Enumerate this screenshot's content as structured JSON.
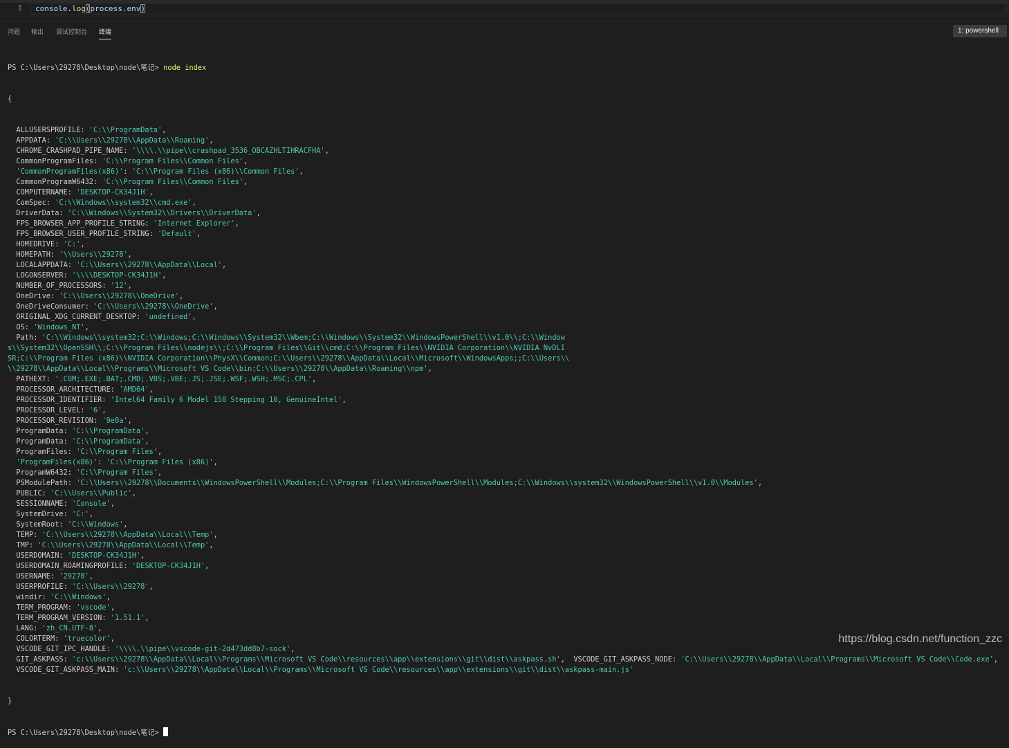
{
  "editor": {
    "line_number": "1",
    "code_object": "console",
    "code_dot": ".",
    "code_fn": "log",
    "code_open": "(",
    "code_arg": "process",
    "code_dot2": ".",
    "code_prop": "env",
    "code_close": ")"
  },
  "panel": {
    "tabs": [
      "问题",
      "输出",
      "调试控制台",
      "终端"
    ],
    "active_tab": "终端",
    "terminal_select": "1: powershell"
  },
  "terminal": {
    "prompt": "PS C:\\Users\\29278\\Desktop\\node\\笔记> ",
    "command": "node index",
    "open_brace": "{",
    "close_brace": "}",
    "entries": [
      {
        "key": "  ALLUSERSPROFILE: ",
        "val": "'C:\\\\ProgramData'",
        "end": ","
      },
      {
        "key": "  APPDATA: ",
        "val": "'C:\\\\Users\\\\29278\\\\AppData\\\\Roaming'",
        "end": ","
      },
      {
        "key": "  CHROME_CRASHPAD_PIPE_NAME: ",
        "val": "'\\\\\\\\.\\\\pipe\\\\crashpad_3536_OBCAZHLTIHRACFHA'",
        "end": ","
      },
      {
        "key": "  CommonProgramFiles: ",
        "val": "'C:\\\\Program Files\\\\Common Files'",
        "end": ","
      },
      {
        "key": "  ",
        "val": "'CommonProgramFiles(x86)'",
        "mid": ": ",
        "val2": "'C:\\\\Program Files (x86)\\\\Common Files'",
        "end": ","
      },
      {
        "key": "  CommonProgramW6432: ",
        "val": "'C:\\\\Program Files\\\\Common Files'",
        "end": ","
      },
      {
        "key": "  COMPUTERNAME: ",
        "val": "'DESKTOP-CK34J1H'",
        "end": ","
      },
      {
        "key": "  ComSpec: ",
        "val": "'C:\\\\Windows\\\\system32\\\\cmd.exe'",
        "end": ","
      },
      {
        "key": "  DriverData: ",
        "val": "'C:\\\\Windows\\\\System32\\\\Drivers\\\\DriverData'",
        "end": ","
      },
      {
        "key": "  FPS_BROWSER_APP_PROFILE_STRING: ",
        "val": "'Internet Explorer'",
        "end": ","
      },
      {
        "key": "  FPS_BROWSER_USER_PROFILE_STRING: ",
        "val": "'Default'",
        "end": ","
      },
      {
        "key": "  HOMEDRIVE: ",
        "val": "'C:'",
        "end": ","
      },
      {
        "key": "  HOMEPATH: ",
        "val": "'\\\\Users\\\\29278'",
        "end": ","
      },
      {
        "key": "  LOCALAPPDATA: ",
        "val": "'C:\\\\Users\\\\29278\\\\AppData\\\\Local'",
        "end": ","
      },
      {
        "key": "  LOGONSERVER: ",
        "val": "'\\\\\\\\DESKTOP-CK34J1H'",
        "end": ","
      },
      {
        "key": "  NUMBER_OF_PROCESSORS: ",
        "val": "'12'",
        "end": ","
      },
      {
        "key": "  OneDrive: ",
        "val": "'C:\\\\Users\\\\29278\\\\OneDrive'",
        "end": ","
      },
      {
        "key": "  OneDriveConsumer: ",
        "val": "'C:\\\\Users\\\\29278\\\\OneDrive'",
        "end": ","
      },
      {
        "key": "  ORIGINAL_XDG_CURRENT_DESKTOP: ",
        "val": "'undefined'",
        "end": ","
      },
      {
        "key": "  OS: ",
        "val": "'Windows_NT'",
        "end": ","
      },
      {
        "key": "  Path: ",
        "val": "'C:\\\\Windows\\\\system32;C:\\\\Windows;C:\\\\Windows\\\\System32\\\\Wbem;C:\\\\Windows\\\\System32\\\\WindowsPowerShell\\\\v1.0\\\\;C:\\\\Window",
        "end": ""
      },
      {
        "key": "",
        "val": "s\\\\System32\\\\OpenSSH\\\\;C:\\\\Program Files\\\\nodejs\\\\;C:\\\\Program Files\\\\Git\\\\cmd;C:\\\\Program Files\\\\NVIDIA Corporation\\\\NVIDIA NvDLI",
        "end": ""
      },
      {
        "key": "",
        "val": "SR;C:\\\\Program Files (x86)\\\\NVIDIA Corporation\\\\PhysX\\\\Common;C:\\\\Users\\\\29278\\\\AppData\\\\Local\\\\Microsoft\\\\WindowsApps;;C:\\\\Users\\\\",
        "end": ""
      },
      {
        "key": "",
        "val": "\\\\29278\\\\AppData\\\\Local\\\\Programs\\\\Microsoft VS Code\\\\bin;C:\\\\Users\\\\29278\\\\AppData\\\\Roaming\\\\npm'",
        "end": ","
      },
      {
        "key": "  PATHEXT: ",
        "val": "'.COM;.EXE;.BAT;.CMD;.VBS;.VBE;.JS;.JSE;.WSF;.WSH;.MSC;.CPL'",
        "end": ","
      },
      {
        "key": "  PROCESSOR_ARCHITECTURE: ",
        "val": "'AMD64'",
        "end": ","
      },
      {
        "key": "  PROCESSOR_IDENTIFIER: ",
        "val": "'Intel64 Family 6 Model 158 Stepping 10, GenuineIntel'",
        "end": ","
      },
      {
        "key": "  PROCESSOR_LEVEL: ",
        "val": "'6'",
        "end": ","
      },
      {
        "key": "  PROCESSOR_REVISION: ",
        "val": "'9e0a'",
        "end": ","
      },
      {
        "key": "  ProgramData: ",
        "val": "'C:\\\\ProgramData'",
        "end": ","
      },
      {
        "key": "  ProgramData: ",
        "val": "'C:\\\\ProgramData'",
        "end": ","
      },
      {
        "key": "  ProgramFiles: ",
        "val": "'C:\\\\Program Files'",
        "end": ","
      },
      {
        "key": "  ",
        "val": "'ProgramFiles(x86)'",
        "mid": ": ",
        "val2": "'C:\\\\Program Files (x86)'",
        "end": ","
      },
      {
        "key": "  ProgramW6432: ",
        "val": "'C:\\\\Program Files'",
        "end": ","
      },
      {
        "key": "  PSModulePath: ",
        "val": "'C:\\\\Users\\\\29278\\\\Documents\\\\WindowsPowerShell\\\\Modules;C:\\\\Program Files\\\\WindowsPowerShell\\\\Modules;C:\\\\Windows\\\\system32\\\\WindowsPowerShell\\\\v1.0\\\\Modules'",
        "end": ","
      },
      {
        "key": "  PUBLIC: ",
        "val": "'C:\\\\Users\\\\Public'",
        "end": ","
      },
      {
        "key": "  SESSIONNAME: ",
        "val": "'Console'",
        "end": ","
      },
      {
        "key": "  SystemDrive: ",
        "val": "'C:'",
        "end": ","
      },
      {
        "key": "  SystemRoot: ",
        "val": "'C:\\\\Windows'",
        "end": ","
      },
      {
        "key": "  TEMP: ",
        "val": "'C:\\\\Users\\\\29278\\\\AppData\\\\Local\\\\Temp'",
        "end": ","
      },
      {
        "key": "  TMP: ",
        "val": "'C:\\\\Users\\\\29278\\\\AppData\\\\Local\\\\Temp'",
        "end": ","
      },
      {
        "key": "  USERDOMAIN: ",
        "val": "'DESKTOP-CK34J1H'",
        "end": ","
      },
      {
        "key": "  USERDOMAIN_ROAMINGPROFILE: ",
        "val": "'DESKTOP-CK34J1H'",
        "end": ","
      },
      {
        "key": "  USERNAME: ",
        "val": "'29278'",
        "end": ","
      },
      {
        "key": "  USERPROFILE: ",
        "val": "'C:\\\\Users\\\\29278'",
        "end": ","
      },
      {
        "key": "  windir: ",
        "val": "'C:\\\\Windows'",
        "end": ","
      },
      {
        "key": "  TERM_PROGRAM: ",
        "val": "'vscode'",
        "end": ","
      },
      {
        "key": "  TERM_PROGRAM_VERSION: ",
        "val": "'1.51.1'",
        "end": ","
      },
      {
        "key": "  LANG: ",
        "val": "'zh_CN.UTF-8'",
        "end": ","
      },
      {
        "key": "  COLORTERM: ",
        "val": "'truecolor'",
        "end": ","
      },
      {
        "key": "  VSCODE_GIT_IPC_HANDLE: ",
        "val": "'\\\\\\\\.\\\\pipe\\\\vscode-git-2d473dd8b7-sock'",
        "end": ","
      },
      {
        "key": "  GIT_ASKPASS: ",
        "val": "'c:\\\\Users\\\\29278\\\\AppData\\\\Local\\\\Programs\\\\Microsoft VS Code\\\\resources\\\\app\\\\extensions\\\\git\\\\dist\\\\askpass.sh'",
        "mid": ",  VSCODE_GIT_ASKPASS_NODE: ",
        "val2": "'C:\\\\Users\\\\29278\\\\AppData\\\\Local\\\\Programs\\\\Microsoft VS Code\\\\Code.exe'",
        "end": ","
      },
      {
        "key": "  VSCODE_GIT_ASKPASS_MAIN: ",
        "val": "'c:\\\\Users\\\\29278\\\\AppData\\\\Local\\\\Programs\\\\Microsoft VS Code\\\\resources\\\\app\\\\extensions\\\\git\\\\dist\\\\askpass-main.js'",
        "end": ""
      }
    ],
    "final_prompt": "PS C:\\Users\\29278\\Desktop\\node\\笔记> "
  },
  "watermark": "https://blog.csdn.net/function_zzc"
}
